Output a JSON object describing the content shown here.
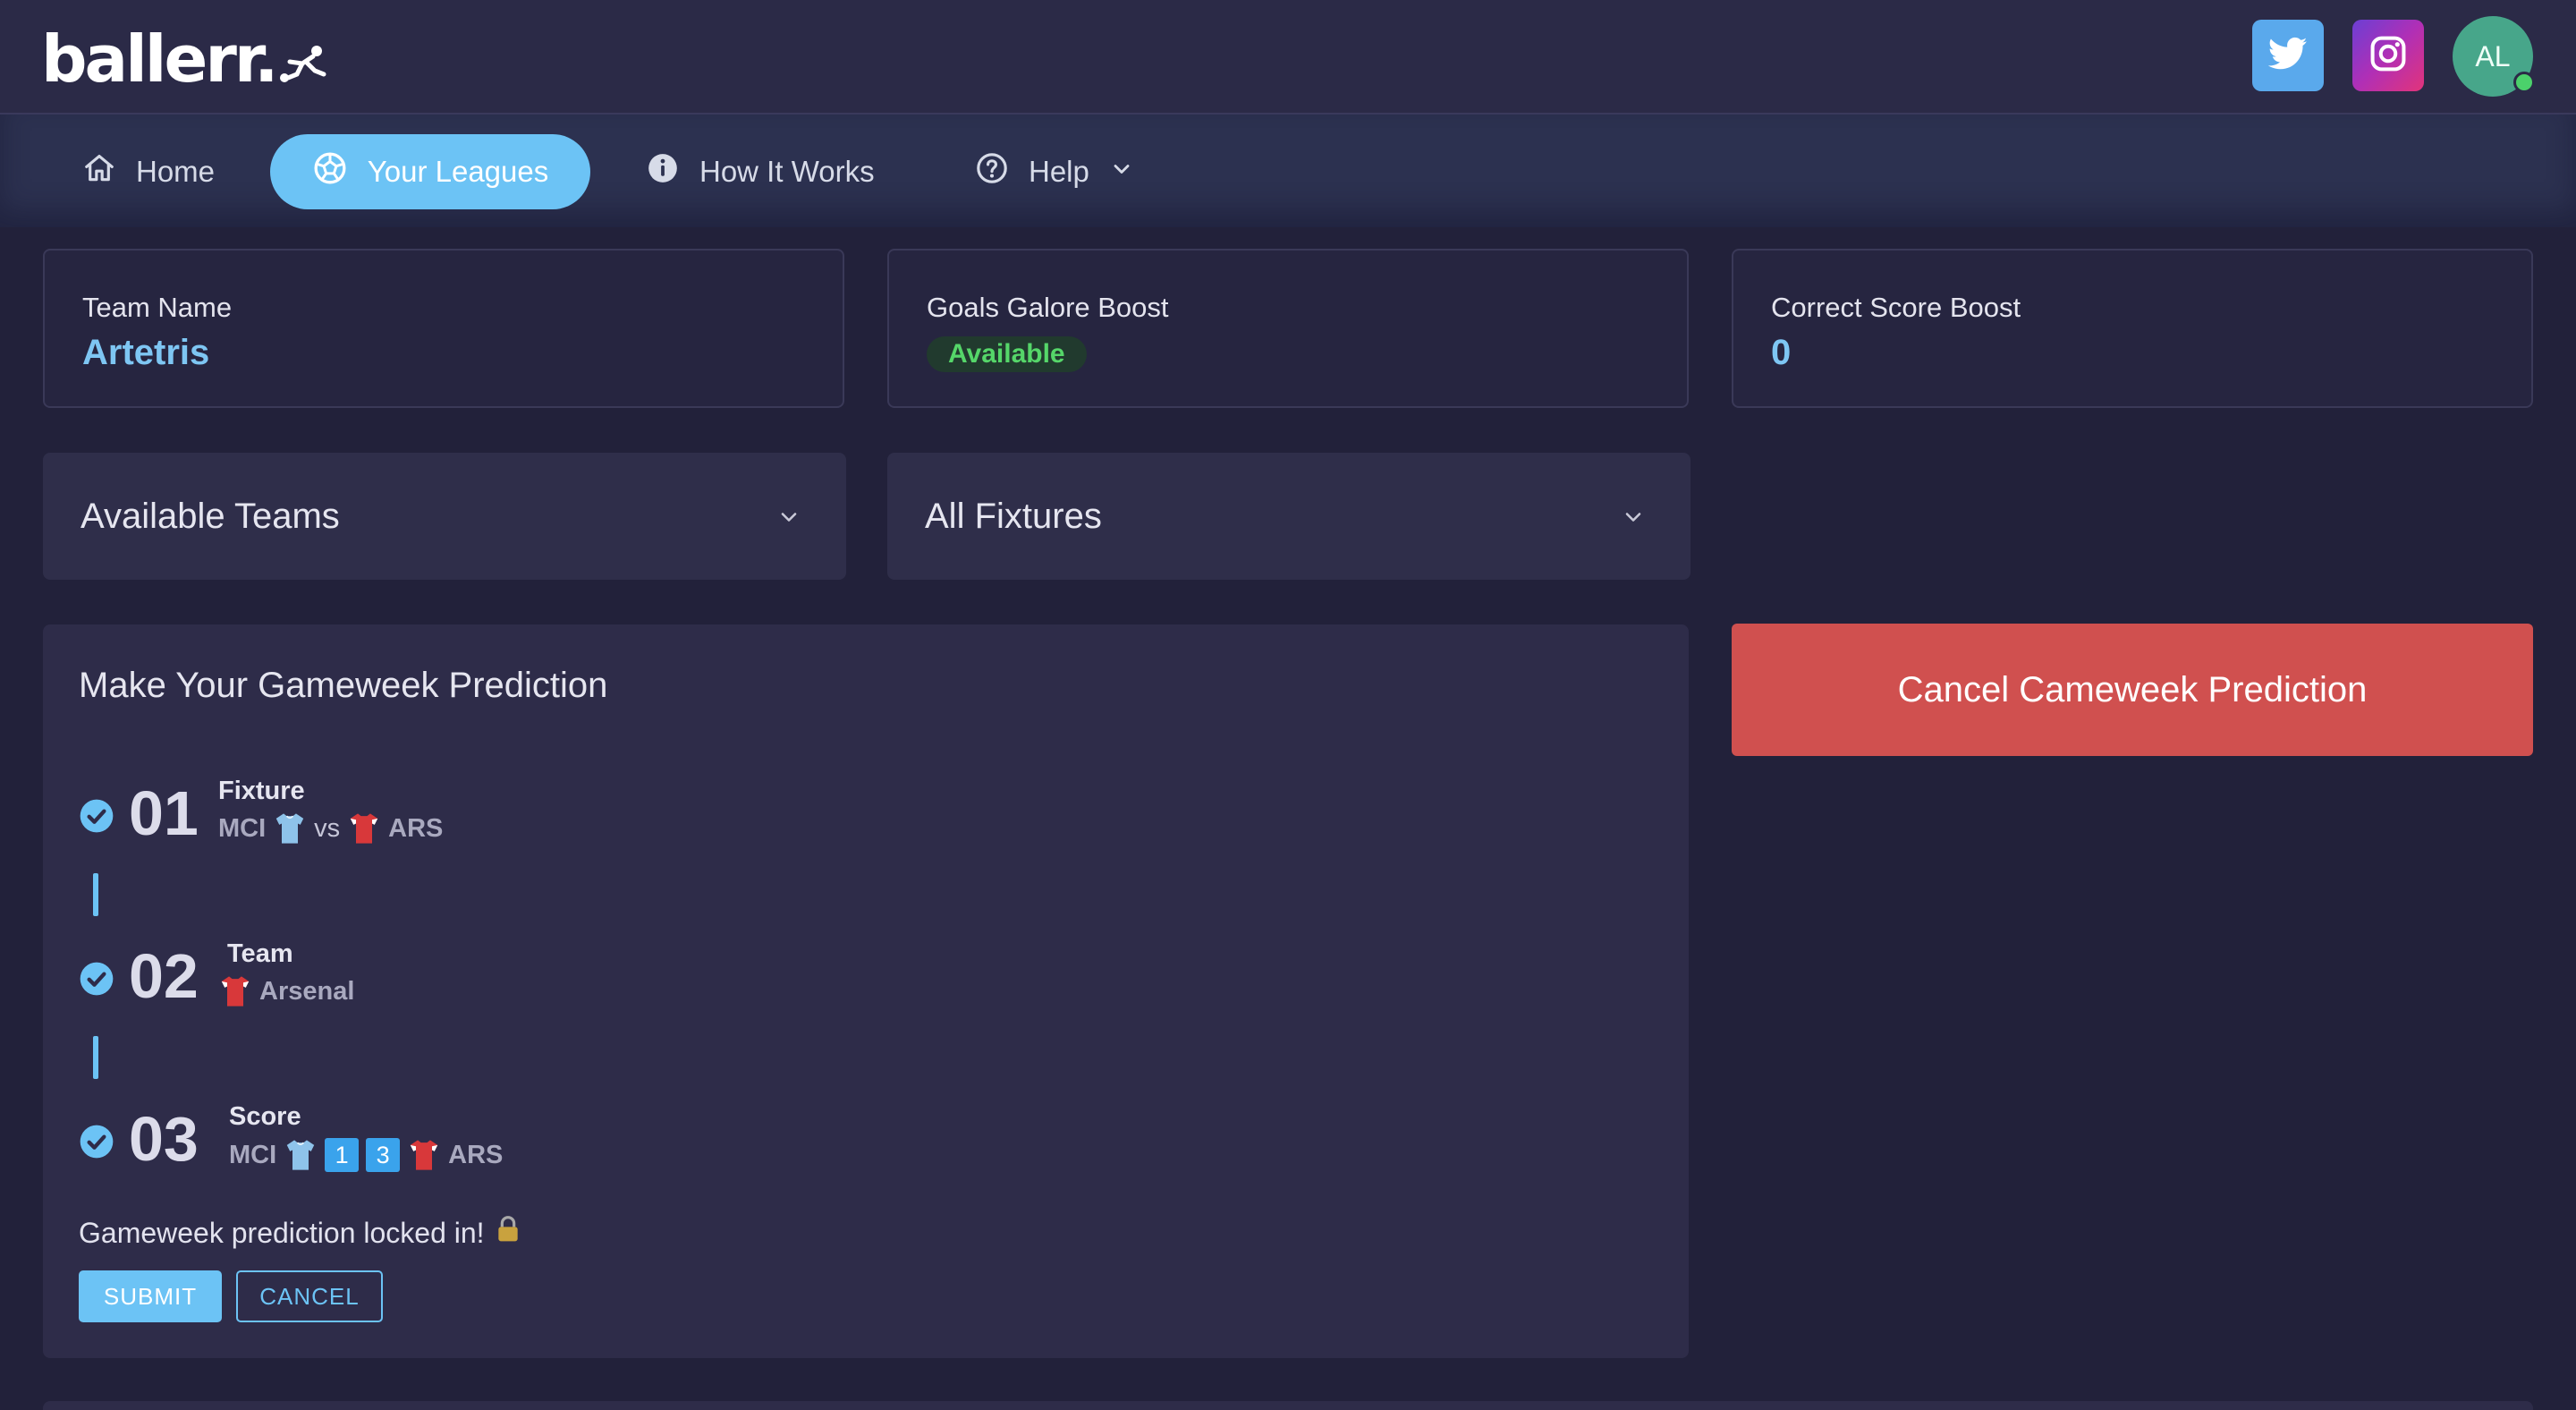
{
  "header": {
    "logo_text": "ballerr.",
    "social": [
      {
        "name": "twitter",
        "icon": "twitter-bird-icon",
        "color": "#5aa9ec"
      },
      {
        "name": "instagram",
        "icon": "instagram-camera-icon",
        "color": "#b02fb6"
      }
    ],
    "avatar_initials": "AL"
  },
  "nav": {
    "items": [
      {
        "label": "Home",
        "icon": "home-icon"
      },
      {
        "label": "Your Leagues",
        "icon": "soccer-ball-icon",
        "active": true
      },
      {
        "label": "How It Works",
        "icon": "info-icon"
      },
      {
        "label": "Help",
        "icon": "question-icon",
        "has_dropdown": true
      }
    ]
  },
  "cards": {
    "team_name": {
      "label": "Team Name",
      "value": "Artetris"
    },
    "goals_galore": {
      "label": "Goals Galore Boost",
      "value": "Available"
    },
    "correct_score": {
      "label": "Correct Score Boost",
      "value": "0"
    }
  },
  "selects": {
    "teams": {
      "label": "Available Teams"
    },
    "fixtures": {
      "label": "All Fixtures"
    }
  },
  "prediction": {
    "title": "Make Your Gameweek Prediction",
    "steps": [
      {
        "number": "01",
        "title": "Fixture",
        "home": "MCI",
        "vs": "vs",
        "away": "ARS"
      },
      {
        "number": "02",
        "title": "Team",
        "team": "Arsenal"
      },
      {
        "number": "03",
        "title": "Score",
        "home": "MCI",
        "home_score": "1",
        "away_score": "3",
        "away": "ARS"
      }
    ],
    "locked_message": "Gameweek prediction locked in!",
    "submit_label": "SUBMIT",
    "cancel_label": "CANCEL"
  },
  "cancel_prediction_label": "Cancel Cameweek Prediction",
  "colors": {
    "background": "#22213a",
    "accent": "#6cc3f5",
    "danger": "#d0504f",
    "success": "#55d669",
    "man_city_shirt": "#8ec3ea",
    "arsenal_shirt": "#d8383a"
  }
}
